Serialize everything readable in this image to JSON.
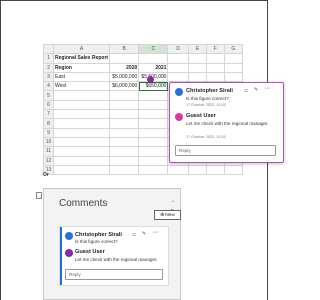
{
  "spreadsheet": {
    "columns": [
      "A",
      "B",
      "C",
      "D",
      "E",
      "F",
      "G"
    ],
    "rows": [
      {
        "num": "1",
        "cells": [
          "Regional Sales Report",
          "",
          "",
          "",
          "",
          "",
          ""
        ]
      },
      {
        "num": "2",
        "cells": [
          "Region",
          "2020",
          "2021",
          "",
          "",
          "",
          ""
        ]
      },
      {
        "num": "3",
        "cells": [
          "East",
          "$5,000,000",
          "$5,500,000",
          "",
          "",
          "",
          ""
        ]
      },
      {
        "num": "4",
        "cells": [
          "West",
          "$6,000,000",
          "$650,000",
          "",
          "",
          "",
          ""
        ]
      },
      {
        "num": "5",
        "cells": [
          "",
          "",
          "",
          "",
          "",
          "",
          ""
        ]
      },
      {
        "num": "6",
        "cells": [
          "",
          "",
          "",
          "",
          "",
          "",
          ""
        ]
      },
      {
        "num": "7",
        "cells": [
          "",
          "",
          "",
          "",
          "",
          "",
          ""
        ]
      },
      {
        "num": "8",
        "cells": [
          "",
          "",
          "",
          "",
          "",
          "",
          ""
        ]
      },
      {
        "num": "9",
        "cells": [
          "",
          "",
          "",
          "",
          "",
          "",
          ""
        ]
      },
      {
        "num": "10",
        "cells": [
          "",
          "",
          "",
          "",
          "",
          "",
          ""
        ]
      },
      {
        "num": "11",
        "cells": [
          "",
          "",
          "",
          "",
          "",
          "",
          ""
        ]
      },
      {
        "num": "12",
        "cells": [
          "",
          "",
          "",
          "",
          "",
          "",
          ""
        ]
      },
      {
        "num": "13",
        "cells": [
          "",
          "",
          "",
          "",
          "",
          "",
          ""
        ]
      }
    ]
  },
  "comment_card": {
    "author": "Christopher Sirali",
    "author_text": "Is this figure correct?",
    "author_date": "17 October 2022, 10:31",
    "reply_author": "Guest User",
    "reply_text": "Let me check with the regional manager.",
    "reply_date": "17 October 2022, 10:31",
    "reply_placeholder": "Reply",
    "icons": [
      "link-icon",
      "edit-icon",
      "more-icon"
    ]
  },
  "or_label": "Or",
  "comments_pane": {
    "title": "Comments",
    "new_label": "New",
    "author": "Christopher Sirali",
    "author_text": "Is this figure correct?",
    "reply_author": "Guest User",
    "reply_text": "Let me check with the regional manager.",
    "reply_placeholder": "Reply"
  },
  "colors": {
    "accent_purple": "#b34cc6",
    "excel_green": "#1f7a3c",
    "avatar_blue": "#2b6fd6",
    "avatar_pink": "#d33aa3"
  }
}
